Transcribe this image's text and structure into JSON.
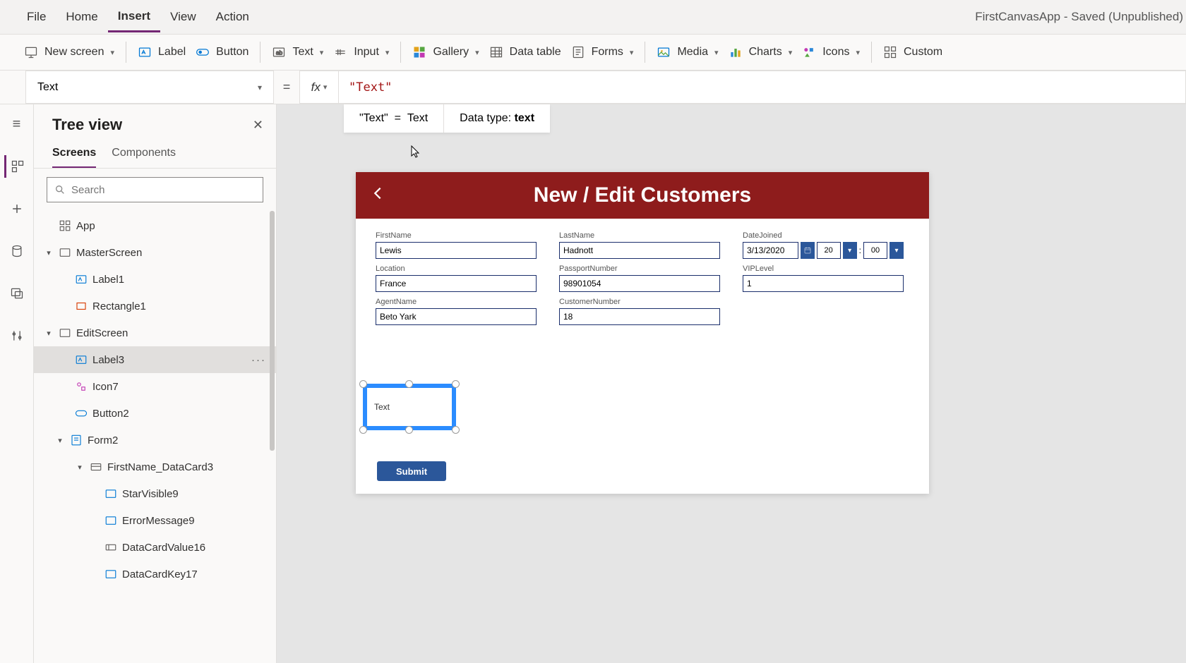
{
  "app_title": "FirstCanvasApp - Saved (Unpublished)",
  "menubar": [
    "File",
    "Home",
    "Insert",
    "View",
    "Action"
  ],
  "active_menu": "Insert",
  "ribbon": {
    "new_screen": "New screen",
    "label": "Label",
    "button": "Button",
    "text": "Text",
    "input": "Input",
    "gallery": "Gallery",
    "data_table": "Data table",
    "forms": "Forms",
    "media": "Media",
    "charts": "Charts",
    "icons": "Icons",
    "custom": "Custom"
  },
  "property_dropdown": "Text",
  "formula": "\"Text\"",
  "formula_result_lhs": "\"Text\"",
  "formula_result_rhs": "Text",
  "datatype_label": "Data type:",
  "datatype_value": "text",
  "tree": {
    "title": "Tree view",
    "tabs": [
      "Screens",
      "Components"
    ],
    "active_tab": "Screens",
    "search_placeholder": "Search",
    "nodes": {
      "app": "App",
      "master_screen": "MasterScreen",
      "label1": "Label1",
      "rectangle1": "Rectangle1",
      "edit_screen": "EditScreen",
      "label3": "Label3",
      "icon7": "Icon7",
      "button2": "Button2",
      "form2": "Form2",
      "datacard": "FirstName_DataCard3",
      "starvisible": "StarVisible9",
      "errormessage": "ErrorMessage9",
      "datacardvalue": "DataCardValue16",
      "datacardkey": "DataCardKey17"
    }
  },
  "screen": {
    "title": "New / Edit Customers",
    "fields": {
      "firstname_label": "FirstName",
      "firstname_value": "Lewis",
      "lastname_label": "LastName",
      "lastname_value": "Hadnott",
      "datejoined_label": "DateJoined",
      "datejoined_value": "3/13/2020",
      "hour": "20",
      "minute": "00",
      "location_label": "Location",
      "location_value": "France",
      "passport_label": "PassportNumber",
      "passport_value": "98901054",
      "vip_label": "VIPLevel",
      "vip_value": "1",
      "agent_label": "AgentName",
      "agent_value": "Beto Yark",
      "custnum_label": "CustomerNumber",
      "custnum_value": "18"
    },
    "selected_label_text": "Text",
    "submit": "Submit"
  }
}
